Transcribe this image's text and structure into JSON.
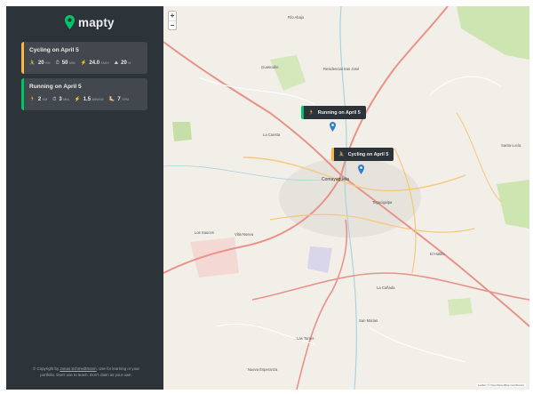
{
  "app": {
    "name": "mapty"
  },
  "workouts": [
    {
      "type": "cycling",
      "title": "Cycling on April 5",
      "details": [
        {
          "icon": "🚴",
          "value": "20",
          "unit": "KM"
        },
        {
          "icon": "⏱",
          "value": "50",
          "unit": "MIN"
        },
        {
          "icon": "⚡️",
          "value": "24.0",
          "unit": "KM/H"
        },
        {
          "icon": "⛰",
          "value": "20",
          "unit": "M"
        }
      ]
    },
    {
      "type": "running",
      "title": "Running on April 5",
      "details": [
        {
          "icon": "🏃",
          "value": "2",
          "unit": "KM"
        },
        {
          "icon": "⏱",
          "value": "3",
          "unit": "MIN"
        },
        {
          "icon": "⚡️",
          "value": "1.5",
          "unit": "MIN/KM"
        },
        {
          "icon": "🦶🏼",
          "value": "7",
          "unit": "SPM"
        }
      ]
    }
  ],
  "copyright": {
    "prefix": "© Copyright by ",
    "author": "Jonas Schmedtmann",
    "suffix": ". Use for learning or your portfolio. Don't use to teach. Don't claim as your own."
  },
  "map": {
    "zoom_in": "+",
    "zoom_out": "−",
    "popups": [
      {
        "type": "running",
        "icon": "🏃",
        "label": "Running on April 5"
      },
      {
        "type": "cycling",
        "icon": "🚴",
        "label": "Cycling on April 5"
      }
    ],
    "place_labels": [
      "Río Abajo",
      "Guasculile",
      "Residencial San José",
      "La Cuesta",
      "Comayagüela",
      "Santa Lucía",
      "Los Sauces",
      "El Hatillo",
      "Tegucigalpa",
      "La Cañada",
      "Villa Nueva",
      "Las Torres",
      "San Matías",
      "Nueva Esperanza"
    ],
    "attribution": "Leaflet | © OpenStreetMap contributors"
  },
  "colors": {
    "sidebar": "#2d3439",
    "card": "#42484d",
    "cycling": "#ffb545",
    "running": "#00c46a",
    "map_bg": "#f2efe9",
    "road_major": "#e8928a",
    "road_secondary": "#f5c87a",
    "pin": "#2a81cb"
  }
}
